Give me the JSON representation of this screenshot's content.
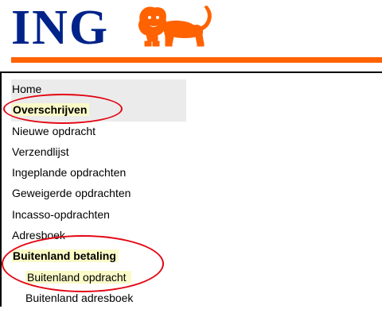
{
  "brand": {
    "name": "ING",
    "logo_icon": "lion-logo-icon",
    "accent": "#ff6200",
    "brand_blue": "#00238a"
  },
  "menu": {
    "items": [
      {
        "label": "Home",
        "bold": false
      },
      {
        "label": "Overschrijven",
        "bold": true
      },
      {
        "label": "Nieuwe opdracht",
        "bold": false
      },
      {
        "label": "Verzendlijst",
        "bold": false
      },
      {
        "label": "Ingeplande opdrachten",
        "bold": false
      },
      {
        "label": "Geweigerde opdrachten",
        "bold": false
      },
      {
        "label": "Incasso-opdrachten",
        "bold": false
      },
      {
        "label": "Adresboek",
        "bold": false
      },
      {
        "label": "Buitenland betaling",
        "bold": true
      },
      {
        "label": "Buitenland opdracht",
        "bold": false
      },
      {
        "label": "Buitenland adresboek",
        "bold": false
      }
    ]
  },
  "annotation_color": "#e30613"
}
